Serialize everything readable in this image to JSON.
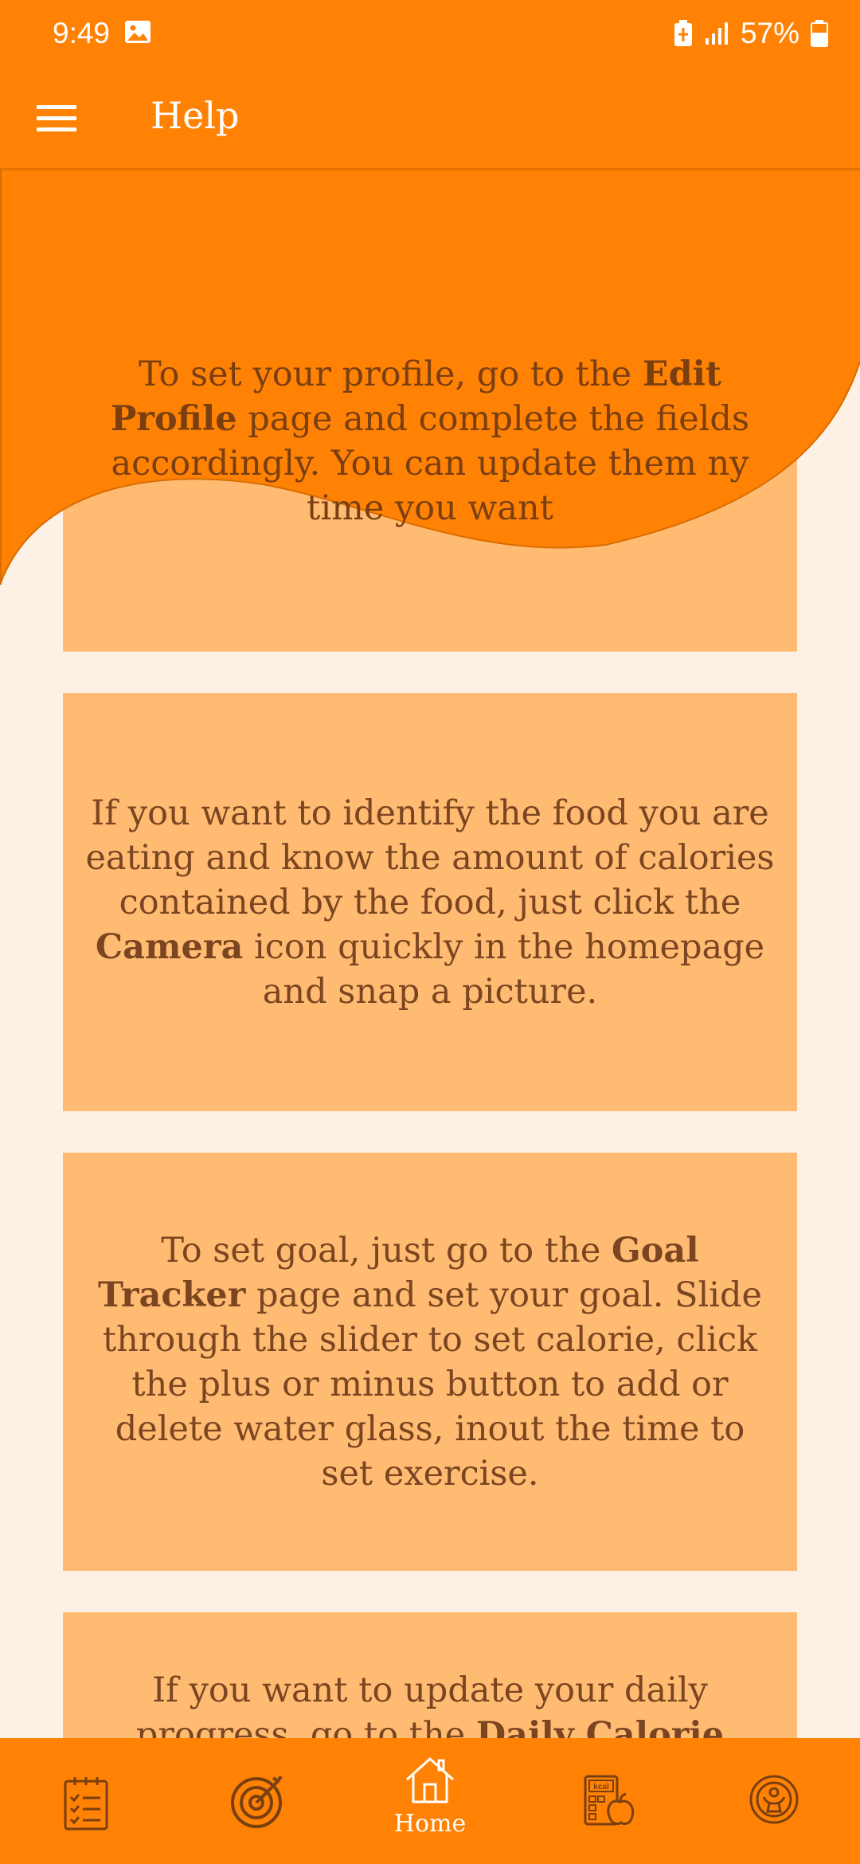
{
  "status_bar": {
    "time": "9:49",
    "battery": "57%",
    "icons": [
      "image-icon",
      "battery-saver-icon",
      "signal-icon",
      "battery-icon"
    ]
  },
  "app_bar": {
    "title": "Help",
    "menu_icon": "hamburger-menu-icon"
  },
  "cards": [
    {
      "parts": [
        {
          "text": "To set your profile, go to the ",
          "bold": false
        },
        {
          "text": "Edit Profile",
          "bold": true
        },
        {
          "text": " page and complete the fields accordingly. You can update them ny time you want",
          "bold": false
        }
      ]
    },
    {
      "parts": [
        {
          "text": "If you want to identify the food you are eating and know the amount of calories contained by the food, just click the ",
          "bold": false
        },
        {
          "text": "Camera",
          "bold": true
        },
        {
          "text": " icon quickly in the homepage and snap a picture.",
          "bold": false
        }
      ]
    },
    {
      "parts": [
        {
          "text": "To set goal, just go to the ",
          "bold": false
        },
        {
          "text": "Goal Tracker",
          "bold": true
        },
        {
          "text": " page and set your goal. Slide through the slider to set calorie, click the plus or minus button to add or delete water glass, inout the time to set exercise.",
          "bold": false
        }
      ]
    },
    {
      "parts": [
        {
          "text": "If you want to update your daily progress, go to the ",
          "bold": false
        },
        {
          "text": "Daily Calorie",
          "bold": true
        }
      ]
    }
  ],
  "bottom_nav": {
    "items": [
      {
        "icon": "checklist-icon",
        "label": ""
      },
      {
        "icon": "target-icon",
        "label": ""
      },
      {
        "icon": "home-icon",
        "label": "Home"
      },
      {
        "icon": "kcal-calculator-icon",
        "label": ""
      },
      {
        "icon": "wellness-person-icon",
        "label": ""
      }
    ]
  },
  "colors": {
    "primary": "#ff8204",
    "card": "#ffbb72",
    "background": "#fdf0e5",
    "text": "#7a4520"
  }
}
